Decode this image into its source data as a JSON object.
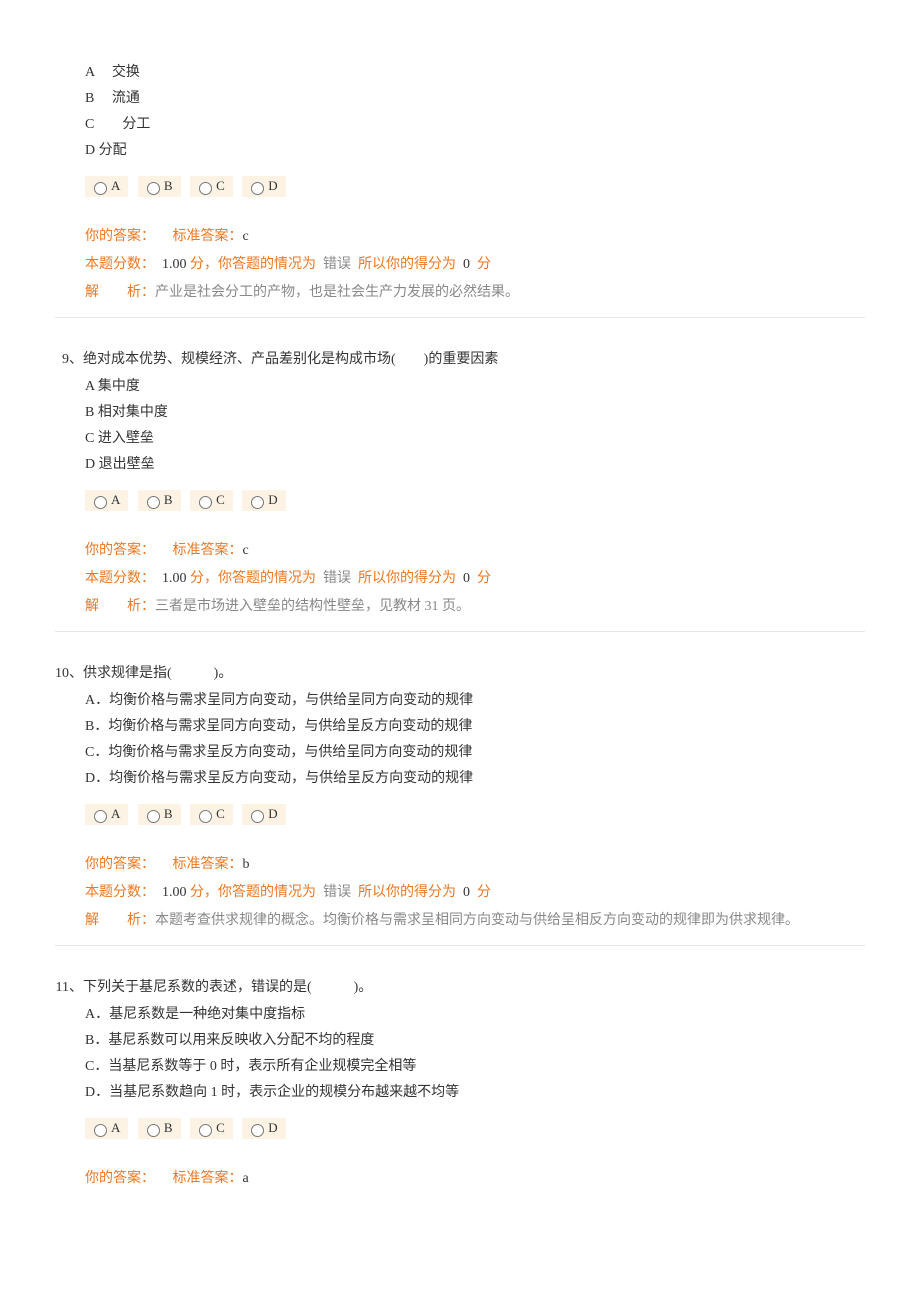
{
  "radio_labels": {
    "a": "A",
    "b": "B",
    "c": "C",
    "d": "D"
  },
  "labels": {
    "your_answer": "你的答案：",
    "std_answer_prefix": "标准答案：",
    "score_prefix": "本题分数：",
    "score_unit": "分，你答题的情况为",
    "score_mid2": "所以你的得分为",
    "score_suffix": "分",
    "analysis_label": "解　　析："
  },
  "q8": {
    "options": {
      "a": "A　 交换",
      "b": "B　 流通",
      "c": "C　　分工",
      "d": "D 分配"
    },
    "std_answer": "c",
    "score": "1.00",
    "status": "错误",
    "got": "0",
    "analysis": "产业是社会分工的产物，也是社会生产力发展的必然结果。"
  },
  "q9": {
    "number": "9、",
    "stem": "绝对成本优势、规模经济、产品差别化是构成市场(　　)的重要因素",
    "options": {
      "a": "A 集中度",
      "b": "B 相对集中度",
      "c": "C 进入壁垒",
      "d": "D 退出壁垒"
    },
    "std_answer": "c",
    "score": "1.00",
    "status": "错误",
    "got": "0",
    "analysis": "三者是市场进入壁垒的结构性壁垒，见教材 31 页。"
  },
  "q10": {
    "number": "10、",
    "stem": "供求规律是指(　　　)。",
    "options": {
      "a": "A．均衡价格与需求呈同方向变动，与供给呈同方向变动的规律",
      "b": "B．均衡价格与需求呈同方向变动，与供给呈反方向变动的规律",
      "c": "C．均衡价格与需求呈反方向变动，与供给呈同方向变动的规律",
      "d": "D．均衡价格与需求呈反方向变动，与供给呈反方向变动的规律"
    },
    "std_answer": "b",
    "score": "1.00",
    "status": "错误",
    "got": "0",
    "analysis": "本题考查供求规律的概念。均衡价格与需求呈相同方向变动与供给呈相反方向变动的规律即为供求规律。"
  },
  "q11": {
    "number": "11、",
    "stem": "下列关于基尼系数的表述，错误的是(　　　)。",
    "options": {
      "a": "A．基尼系数是一种绝对集中度指标",
      "b": "B．基尼系数可以用来反映收入分配不均的程度",
      "c": "C．当基尼系数等于 0 时，表示所有企业规模完全相等",
      "d": "D．当基尼系数趋向 1 时，表示企业的规模分布越来越不均等"
    },
    "std_answer": "a"
  }
}
